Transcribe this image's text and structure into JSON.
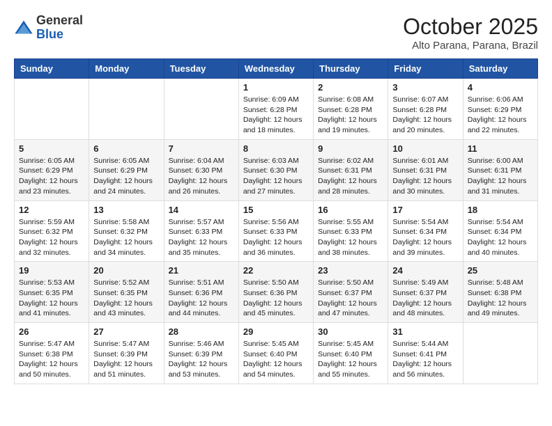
{
  "header": {
    "logo_general": "General",
    "logo_blue": "Blue",
    "month": "October 2025",
    "location": "Alto Parana, Parana, Brazil"
  },
  "weekdays": [
    "Sunday",
    "Monday",
    "Tuesday",
    "Wednesday",
    "Thursday",
    "Friday",
    "Saturday"
  ],
  "weeks": [
    [
      {
        "day": "",
        "info": ""
      },
      {
        "day": "",
        "info": ""
      },
      {
        "day": "",
        "info": ""
      },
      {
        "day": "1",
        "info": "Sunrise: 6:09 AM\nSunset: 6:28 PM\nDaylight: 12 hours and 18 minutes."
      },
      {
        "day": "2",
        "info": "Sunrise: 6:08 AM\nSunset: 6:28 PM\nDaylight: 12 hours and 19 minutes."
      },
      {
        "day": "3",
        "info": "Sunrise: 6:07 AM\nSunset: 6:28 PM\nDaylight: 12 hours and 20 minutes."
      },
      {
        "day": "4",
        "info": "Sunrise: 6:06 AM\nSunset: 6:29 PM\nDaylight: 12 hours and 22 minutes."
      }
    ],
    [
      {
        "day": "5",
        "info": "Sunrise: 6:05 AM\nSunset: 6:29 PM\nDaylight: 12 hours and 23 minutes."
      },
      {
        "day": "6",
        "info": "Sunrise: 6:05 AM\nSunset: 6:29 PM\nDaylight: 12 hours and 24 minutes."
      },
      {
        "day": "7",
        "info": "Sunrise: 6:04 AM\nSunset: 6:30 PM\nDaylight: 12 hours and 26 minutes."
      },
      {
        "day": "8",
        "info": "Sunrise: 6:03 AM\nSunset: 6:30 PM\nDaylight: 12 hours and 27 minutes."
      },
      {
        "day": "9",
        "info": "Sunrise: 6:02 AM\nSunset: 6:31 PM\nDaylight: 12 hours and 28 minutes."
      },
      {
        "day": "10",
        "info": "Sunrise: 6:01 AM\nSunset: 6:31 PM\nDaylight: 12 hours and 30 minutes."
      },
      {
        "day": "11",
        "info": "Sunrise: 6:00 AM\nSunset: 6:31 PM\nDaylight: 12 hours and 31 minutes."
      }
    ],
    [
      {
        "day": "12",
        "info": "Sunrise: 5:59 AM\nSunset: 6:32 PM\nDaylight: 12 hours and 32 minutes."
      },
      {
        "day": "13",
        "info": "Sunrise: 5:58 AM\nSunset: 6:32 PM\nDaylight: 12 hours and 34 minutes."
      },
      {
        "day": "14",
        "info": "Sunrise: 5:57 AM\nSunset: 6:33 PM\nDaylight: 12 hours and 35 minutes."
      },
      {
        "day": "15",
        "info": "Sunrise: 5:56 AM\nSunset: 6:33 PM\nDaylight: 12 hours and 36 minutes."
      },
      {
        "day": "16",
        "info": "Sunrise: 5:55 AM\nSunset: 6:33 PM\nDaylight: 12 hours and 38 minutes."
      },
      {
        "day": "17",
        "info": "Sunrise: 5:54 AM\nSunset: 6:34 PM\nDaylight: 12 hours and 39 minutes."
      },
      {
        "day": "18",
        "info": "Sunrise: 5:54 AM\nSunset: 6:34 PM\nDaylight: 12 hours and 40 minutes."
      }
    ],
    [
      {
        "day": "19",
        "info": "Sunrise: 5:53 AM\nSunset: 6:35 PM\nDaylight: 12 hours and 41 minutes."
      },
      {
        "day": "20",
        "info": "Sunrise: 5:52 AM\nSunset: 6:35 PM\nDaylight: 12 hours and 43 minutes."
      },
      {
        "day": "21",
        "info": "Sunrise: 5:51 AM\nSunset: 6:36 PM\nDaylight: 12 hours and 44 minutes."
      },
      {
        "day": "22",
        "info": "Sunrise: 5:50 AM\nSunset: 6:36 PM\nDaylight: 12 hours and 45 minutes."
      },
      {
        "day": "23",
        "info": "Sunrise: 5:50 AM\nSunset: 6:37 PM\nDaylight: 12 hours and 47 minutes."
      },
      {
        "day": "24",
        "info": "Sunrise: 5:49 AM\nSunset: 6:37 PM\nDaylight: 12 hours and 48 minutes."
      },
      {
        "day": "25",
        "info": "Sunrise: 5:48 AM\nSunset: 6:38 PM\nDaylight: 12 hours and 49 minutes."
      }
    ],
    [
      {
        "day": "26",
        "info": "Sunrise: 5:47 AM\nSunset: 6:38 PM\nDaylight: 12 hours and 50 minutes."
      },
      {
        "day": "27",
        "info": "Sunrise: 5:47 AM\nSunset: 6:39 PM\nDaylight: 12 hours and 51 minutes."
      },
      {
        "day": "28",
        "info": "Sunrise: 5:46 AM\nSunset: 6:39 PM\nDaylight: 12 hours and 53 minutes."
      },
      {
        "day": "29",
        "info": "Sunrise: 5:45 AM\nSunset: 6:40 PM\nDaylight: 12 hours and 54 minutes."
      },
      {
        "day": "30",
        "info": "Sunrise: 5:45 AM\nSunset: 6:40 PM\nDaylight: 12 hours and 55 minutes."
      },
      {
        "day": "31",
        "info": "Sunrise: 5:44 AM\nSunset: 6:41 PM\nDaylight: 12 hours and 56 minutes."
      },
      {
        "day": "",
        "info": ""
      }
    ]
  ]
}
